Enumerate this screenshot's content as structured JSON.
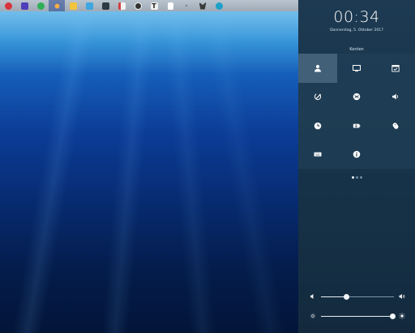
{
  "panel": {
    "time": "00:34",
    "date": "Donnerstag, 5. Oktober 2017",
    "section_label": "Konten",
    "page_dots": 3,
    "active_page": 1
  },
  "sliders": {
    "volume_percent": 35,
    "brightness_percent": 98
  },
  "colors": {
    "panel_bg": "#173349",
    "accent": "#ffffff"
  },
  "taskbar_icons": [
    "app-red-icon",
    "mail-icon",
    "chat-green-icon",
    "browser-icon",
    "folder-icon",
    "file-manager-icon",
    "terminal-icon",
    "document-red-icon",
    "clock-app-icon",
    "text-app-icon",
    "file-icon",
    "small-dot-icon",
    "fox-icon",
    "search-icon"
  ],
  "tiles": [
    "user-icon",
    "display-icon",
    "calendar-icon",
    "settings-wrench-icon",
    "network-icon",
    "volume-icon",
    "time-icon",
    "battery-icon",
    "mouse-icon",
    "keyboard-icon",
    "info-icon"
  ]
}
